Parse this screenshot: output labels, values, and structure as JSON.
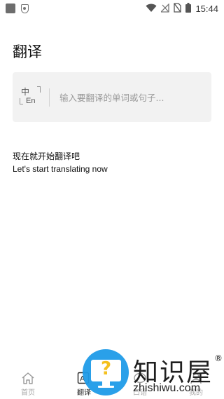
{
  "status_bar": {
    "time": "15:44",
    "icons": [
      "app-icon",
      "shield-icon",
      "wifi-icon",
      "signal-icon",
      "no-sim-icon",
      "battery-icon"
    ]
  },
  "page": {
    "title": "翻译"
  },
  "search": {
    "lang_from": "中",
    "lang_to": "En",
    "placeholder": "输入要翻译的单词或句子..."
  },
  "intro": {
    "title": "现在就开始翻译吧",
    "subtitle": "Let's start translating now"
  },
  "bottom_nav": {
    "items": [
      {
        "label": "首页",
        "icon": "home-icon",
        "active": false
      },
      {
        "label": "翻译",
        "icon": "translate-icon",
        "active": true
      },
      {
        "label": "口语",
        "icon": "chat-icon",
        "active": false
      },
      {
        "label": "我的",
        "icon": "profile-icon",
        "active": false
      }
    ]
  },
  "watermark": {
    "text_cn": "知识屋",
    "registered": "®",
    "url": "zhishiwu.com",
    "colors": {
      "circle": "#1f9be8",
      "question": "#f4c01e"
    }
  }
}
